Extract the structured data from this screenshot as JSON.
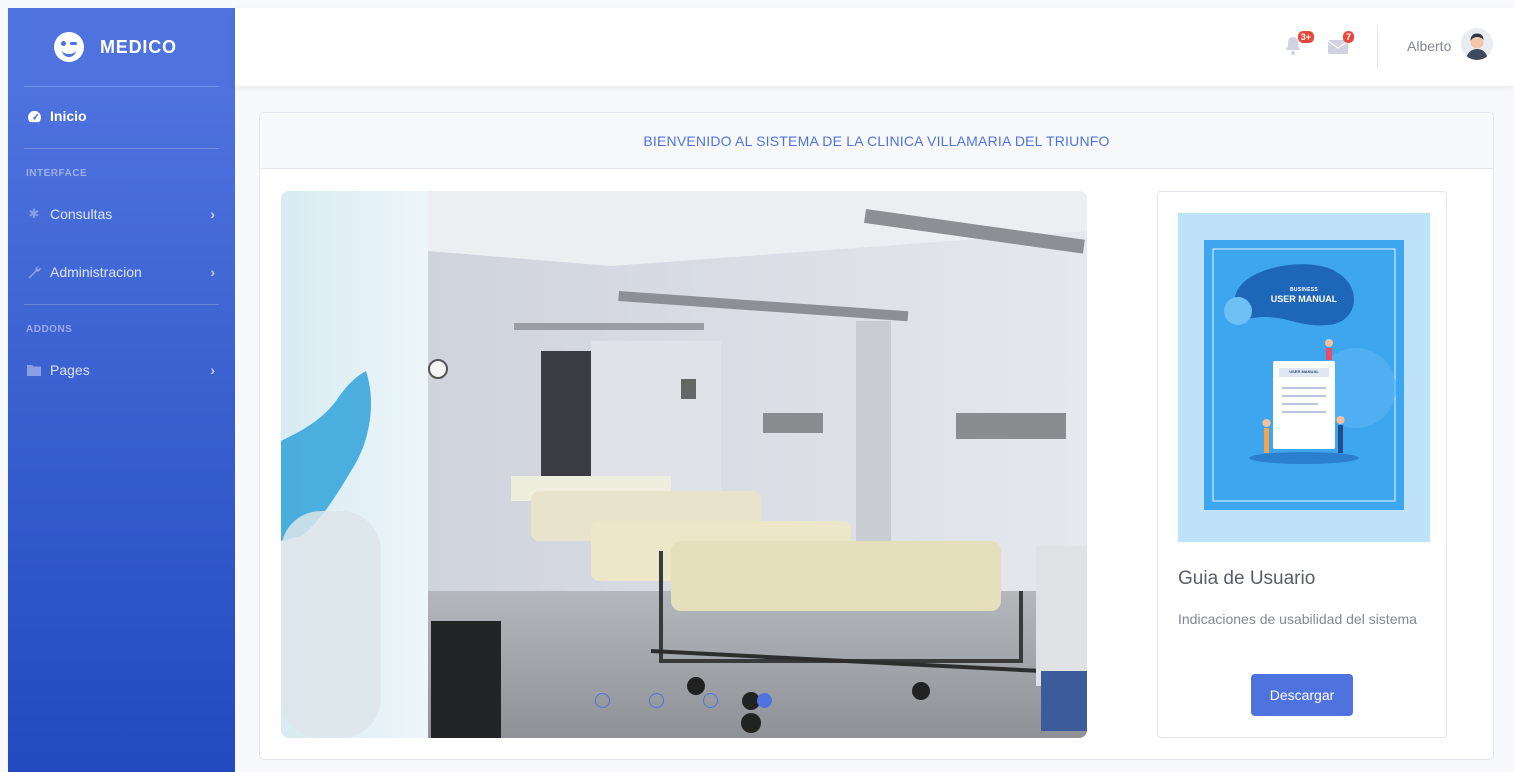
{
  "brand": {
    "name": "MEDICO"
  },
  "sidebar": {
    "items": [
      {
        "label": "Inicio",
        "icon": "tachometer-icon"
      },
      {
        "label": "Consultas",
        "icon": "cog-icon"
      },
      {
        "label": "Administracion",
        "icon": "wrench-icon"
      },
      {
        "label": "Pages",
        "icon": "folder-icon"
      }
    ],
    "headings": [
      "INTERFACE",
      "ADDONS"
    ]
  },
  "topbar": {
    "alerts_count": "3+",
    "messages_count": "7",
    "user_name": "Alberto"
  },
  "main": {
    "header_title": "BIENVENIDO AL SISTEMA DE LA CLINICA VILLAMARIA DEL TRIUNFO",
    "carousel": {
      "slides": 4,
      "active_index": 3
    },
    "guide": {
      "cover_kicker": "BUSINESS",
      "cover_title": "USER MANUAL",
      "cover_doc_label": "USER MANUAL",
      "title": "Guia de Usuario",
      "description": "Indicaciones de usabilidad del sistema",
      "button_label": "Descargar"
    }
  },
  "colors": {
    "primary": "#4e73df",
    "primary_dark": "#224abe",
    "danger": "#e74a3b",
    "text_muted": "#858796"
  }
}
